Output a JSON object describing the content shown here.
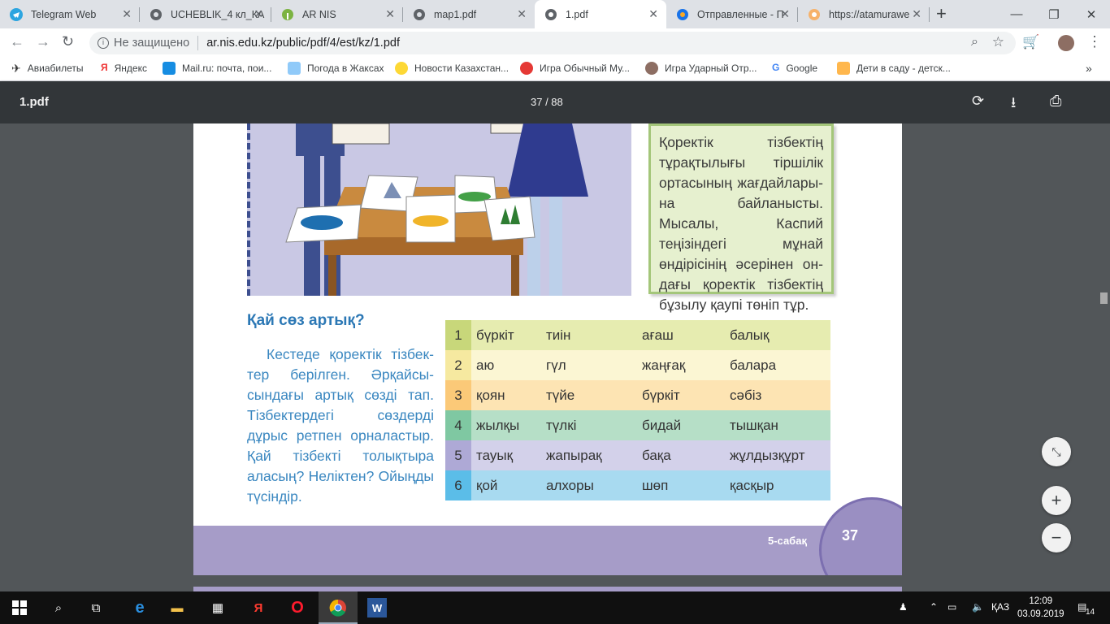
{
  "tabs": [
    {
      "label": "Telegram Web",
      "icon": "telegram-icon"
    },
    {
      "label": "UCHEBLIK_4 кл_КА",
      "icon": "globe-icon"
    },
    {
      "label": "AR NIS",
      "icon": "ar-nis-icon"
    },
    {
      "label": "map1.pdf",
      "icon": "globe-icon"
    },
    {
      "label": "1.pdf",
      "icon": "globe-icon"
    },
    {
      "label": "Отправленные - П",
      "icon": "mail-icon"
    },
    {
      "label": "https://atamurawe",
      "icon": "atamura-icon"
    }
  ],
  "address": {
    "security": "Не защищено",
    "url": "ar.nis.edu.kz/public/pdf/4/est/kz/1.pdf"
  },
  "bookmarks": [
    "Авиабилеты",
    "Яндекс",
    "Mail.ru: почта, пои...",
    "Погода в Жаксах",
    "Новости Казахстан...",
    "Игра Обычный Му...",
    "Игра Ударный Отр...",
    "Google",
    "Дети в саду - детск..."
  ],
  "pdf": {
    "title": "1.pdf",
    "page_indicator": "37 / 88"
  },
  "page": {
    "info_text": "Қоректік тізбектің тұрақтылығы тіршілік ортасының жағдайлары-на байланысты. Мысалы, Каспий теңізіндегі мұнай өндірісінің әсерінен он-дағы қоректік тізбектің бұзылу қаупі төніп тұр.",
    "question_title": "Қай сөз артық?",
    "question_text": "Кестеде қоректік тізбек-тер берілген. Әрқайсы-сындағы артық сөзді тап. Тізбектердегі сөздерді дұрыс ретпен орналастыр. Қай тізбекті толықтыра аласың? Неліктен? Ойыңды түсіндір.",
    "rows": [
      {
        "n": "1",
        "w": [
          "бүркіт",
          "тиін",
          "ағаш",
          "балық"
        ]
      },
      {
        "n": "2",
        "w": [
          "аю",
          "гүл",
          "жаңғақ",
          "балара"
        ]
      },
      {
        "n": "3",
        "w": [
          "қоян",
          "түйе",
          "бүркіт",
          "сәбіз"
        ]
      },
      {
        "n": "4",
        "w": [
          "жылқы",
          "түлкі",
          "бидай",
          "тышқан"
        ]
      },
      {
        "n": "5",
        "w": [
          "тауық",
          "жапырақ",
          "бақа",
          "жұлдызқұрт"
        ]
      },
      {
        "n": "6",
        "w": [
          "қой",
          "алхоры",
          "шөп",
          "қасқыр"
        ]
      }
    ],
    "lesson": "5-сабақ",
    "page_number": "37"
  },
  "taskbar": {
    "lang": "ҚАЗ",
    "time": "12:09",
    "date": "03.09.2019",
    "notif_count": "14"
  },
  "colors": {
    "row_bg": [
      "#e6ecb0",
      "#fbf6d3",
      "#fde4b3",
      "#b6dfc7",
      "#d3d1ea",
      "#a8daf0"
    ],
    "num_bg": [
      "#c8d77a",
      "#f6e9a0",
      "#fbc978",
      "#7fc8a2",
      "#aea9d6",
      "#5bbde8"
    ]
  }
}
